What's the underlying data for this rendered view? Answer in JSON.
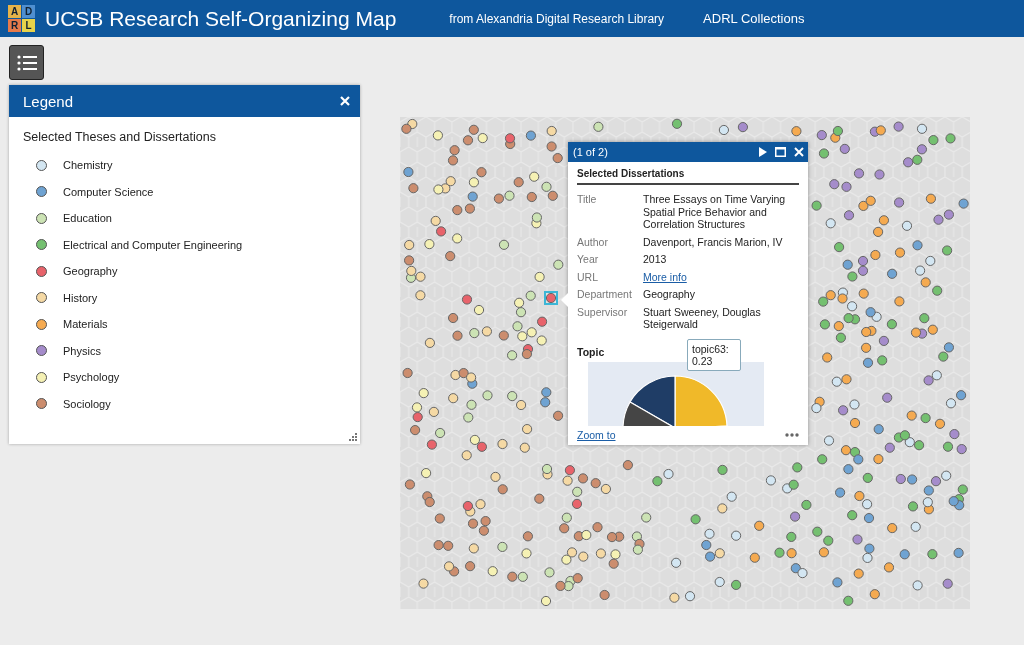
{
  "header": {
    "logo_letters": [
      "A",
      "D",
      "R",
      "L"
    ],
    "title": "UCSB Research Self-Organizing Map",
    "links": [
      "from Alexandria Digital Research Library",
      "ADRL Collections"
    ]
  },
  "legend": {
    "title": "Legend",
    "subtitle": "Selected Theses and Dissertations",
    "items": [
      {
        "label": "Chemistry",
        "color": "#d3e6f2"
      },
      {
        "label": "Computer Science",
        "color": "#6fa3d2"
      },
      {
        "label": "Education",
        "color": "#cce3b4"
      },
      {
        "label": "Electrical and Computer Engineering",
        "color": "#74c070"
      },
      {
        "label": "Geography",
        "color": "#e8636b"
      },
      {
        "label": "History",
        "color": "#f5d9a4"
      },
      {
        "label": "Materials",
        "color": "#f5aa50"
      },
      {
        "label": "Physics",
        "color": "#a58ccb"
      },
      {
        "label": "Psychology",
        "color": "#f5f1b4"
      },
      {
        "label": "Sociology",
        "color": "#cc8d6e"
      }
    ]
  },
  "popup": {
    "counter": "(1 of 2)",
    "heading": "Selected Dissertations",
    "fields": [
      {
        "label": "Title",
        "value": "Three Essays on Time Varying Spatial Price Behavior and Correlation Structures",
        "kind": "text"
      },
      {
        "label": "Author",
        "value": "Davenport, Francis Marion, IV",
        "kind": "text"
      },
      {
        "label": "Year",
        "value": "2013",
        "kind": "text"
      },
      {
        "label": "URL",
        "value": "More info",
        "kind": "link"
      },
      {
        "label": "Department",
        "value": "Geography",
        "kind": "text"
      },
      {
        "label": "Supervisor",
        "value": "Stuart Sweeney, Douglas Steigerwald",
        "kind": "text"
      }
    ],
    "topic_heading": "Topic",
    "tooltip": "topic63: 0.23",
    "footer_link": "Zoom to"
  }
}
